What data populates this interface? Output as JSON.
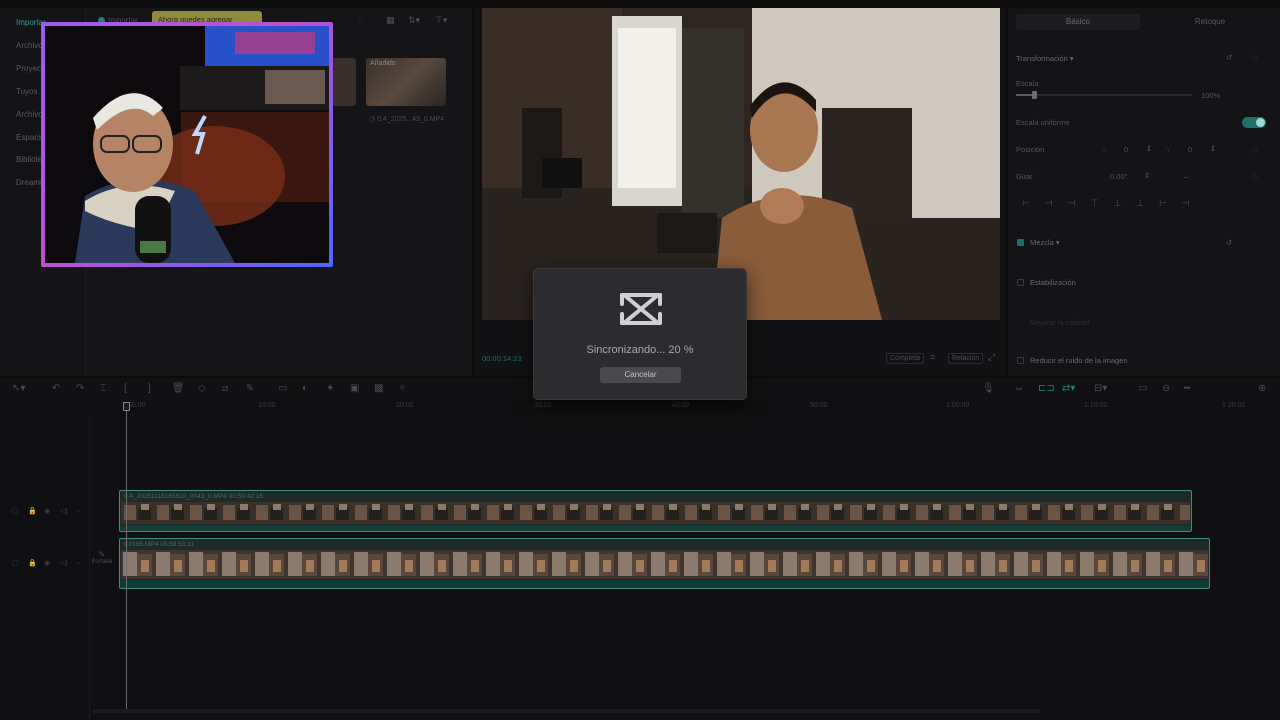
{
  "left_rail": {
    "items": [
      "Importar",
      "Archivo",
      "Proyecto",
      "Tuyos",
      "Archivo",
      "Espacio",
      "Biblioteca",
      "Dreamina"
    ],
    "active_index": 0
  },
  "media_panel": {
    "import_label": "Importar",
    "tooltip": "Ahora puedes agregar",
    "thumb_badge": "Añadido",
    "thumb_caption": "0.4_2025...43_0.MP4"
  },
  "preview": {
    "timecode": "00:00:14:23",
    "buttons": [
      "Completa",
      "Relación"
    ]
  },
  "inspector": {
    "tabs": [
      "Básico",
      "Retoque"
    ],
    "active_tab": 0,
    "transform_header": "Transformación",
    "scale_label": "Escala",
    "scale_value": "100%",
    "scale_level": 0.1,
    "uniform_scale_label": "Escala uniforme",
    "uniform_scale_on": true,
    "position_label": "Posición",
    "pos_x_label": "X",
    "pos_x": "0",
    "pos_y_label": "Y",
    "pos_y": "0",
    "rotate_label": "Girar",
    "rotate_value": "0.00°",
    "rotate_dash": "–",
    "blend_label": "Mezcla",
    "stabilize_label": "Estabilización",
    "stabilize_sub": "Mejorar la calidad",
    "denoise_label": "Reducir el ruido de la imagen"
  },
  "ruler": {
    "labels": [
      "00:00",
      "10:00",
      "20:00",
      "30:00",
      "40:00",
      "50:00",
      "1:00:00",
      "1:10:00",
      "1:20:00"
    ]
  },
  "tracks": {
    "cover_label": "Portada",
    "clip1_title": "0.4_20251118165610_0043_0.MP4  00:59:42:16",
    "clip2_title": "C0165.MP4  00:59:53:11"
  },
  "modal": {
    "status_text": "Sincronizando... 20 %",
    "progress": 0.2,
    "cancel_label": "Cancelar",
    "icon": "capcut-logo"
  },
  "colors": {
    "accent": "#2aa29a",
    "clip_border": "#3f8f7a",
    "webcam_border_start": "#9b5cf2",
    "webcam_border_end": "#4f66ff",
    "tooltip": "#8f8a3d"
  }
}
